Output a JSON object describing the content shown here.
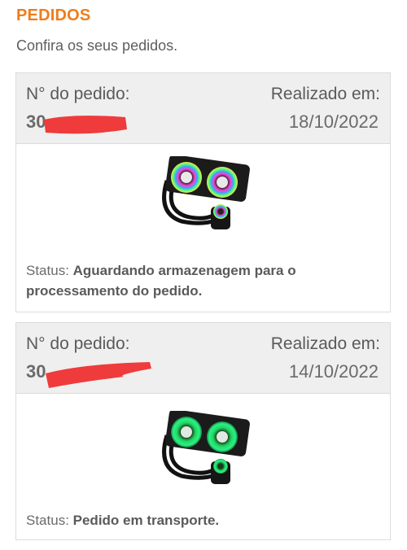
{
  "page": {
    "title": "PEDIDOS",
    "subtitle": "Confira os seus pedidos."
  },
  "orders": [
    {
      "order_label": "N° do pedido:",
      "order_number_visible": "30",
      "date_label": "Realizado em:",
      "date": "18/10/2022",
      "product_image": "water-cooler-rgb-rainbow",
      "status_label": "Status:",
      "status_value": "Aguardando armazenagem para o processamento do pedido."
    },
    {
      "order_label": "N° do pedido:",
      "order_number_visible": "30",
      "date_label": "Realizado em:",
      "date": "14/10/2022",
      "product_image": "water-cooler-rgb-green",
      "status_label": "Status:",
      "status_value": "Pedido em transporte."
    }
  ],
  "colors": {
    "accent": "#ef7d1a",
    "redaction": "#ef3b3b",
    "header_bg": "#efefef"
  }
}
